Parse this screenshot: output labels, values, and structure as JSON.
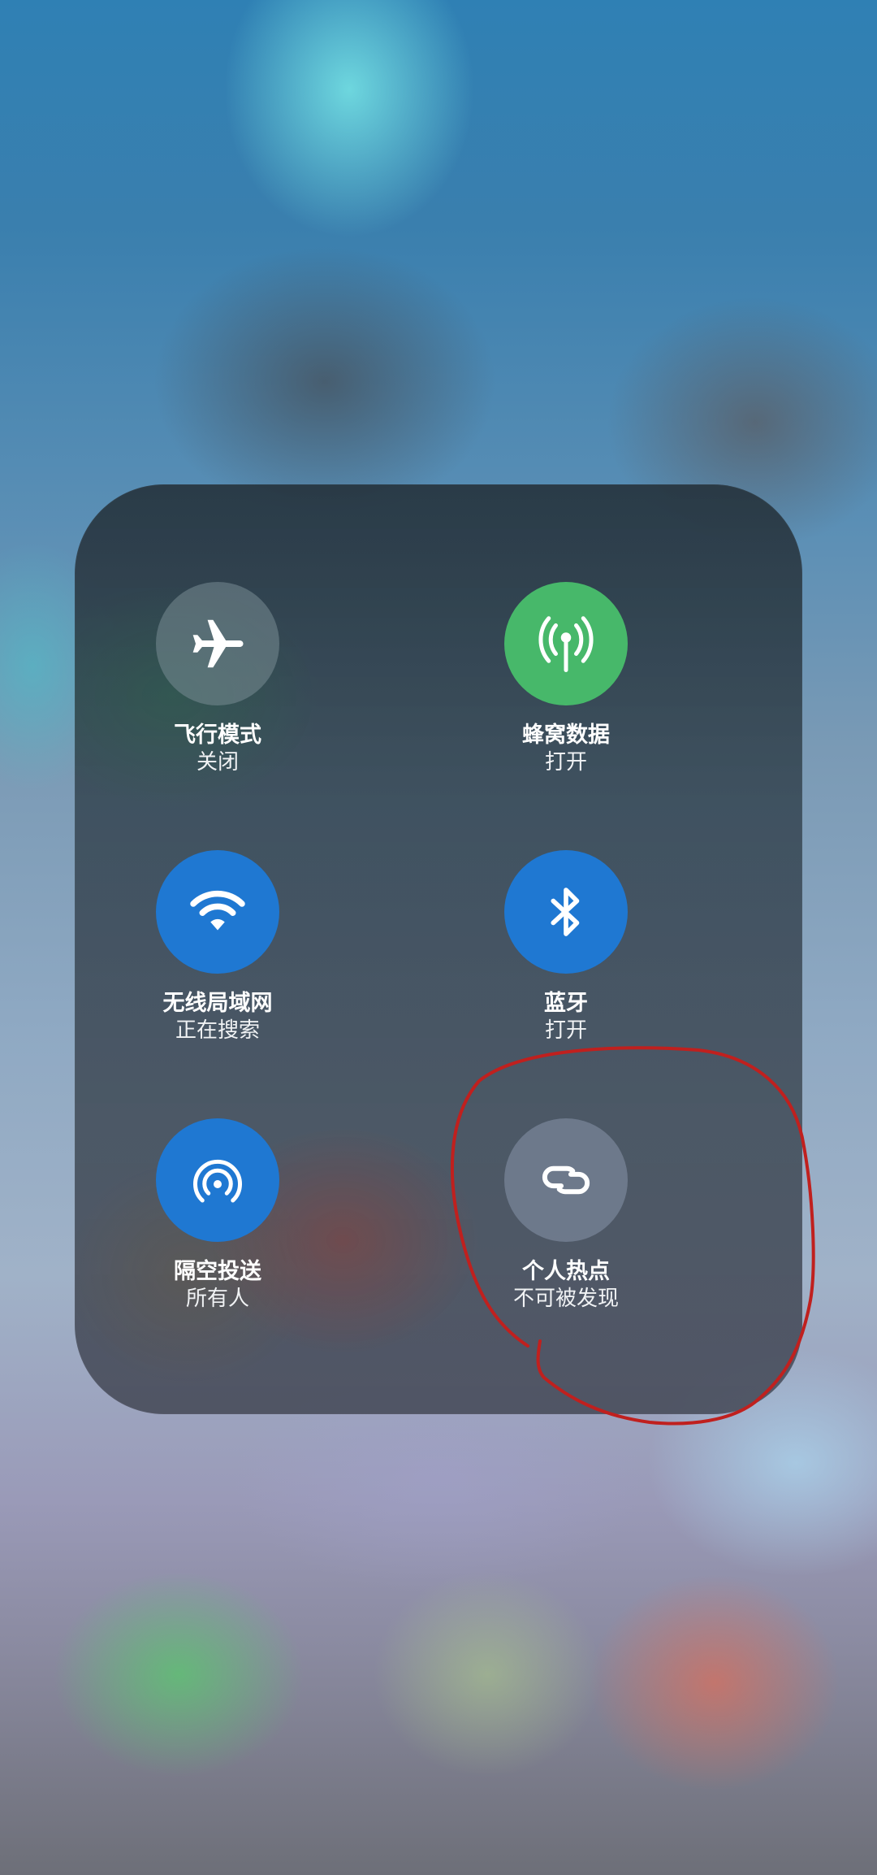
{
  "controls": [
    {
      "title": "飞行模式",
      "status": "关闭",
      "icon": "airplane-icon",
      "color": "#6f8a92"
    },
    {
      "title": "蜂窝数据",
      "status": "打开",
      "icon": "cellular-antenna-icon",
      "color": "#47b86a"
    },
    {
      "title": "无线局域网",
      "status": "正在搜索",
      "icon": "wifi-icon",
      "color": "#1f78d2"
    },
    {
      "title": "蓝牙",
      "status": "打开",
      "icon": "bluetooth-icon",
      "color": "#1f78d2"
    },
    {
      "title": "隔空投送",
      "status": "所有人",
      "icon": "airdrop-icon",
      "color": "#1f78d2"
    },
    {
      "title": "个人热点",
      "status": "不可被发现",
      "icon": "personal-hotspot-icon",
      "color": "#7884a0"
    }
  ],
  "annotation_color": "#c0201e"
}
